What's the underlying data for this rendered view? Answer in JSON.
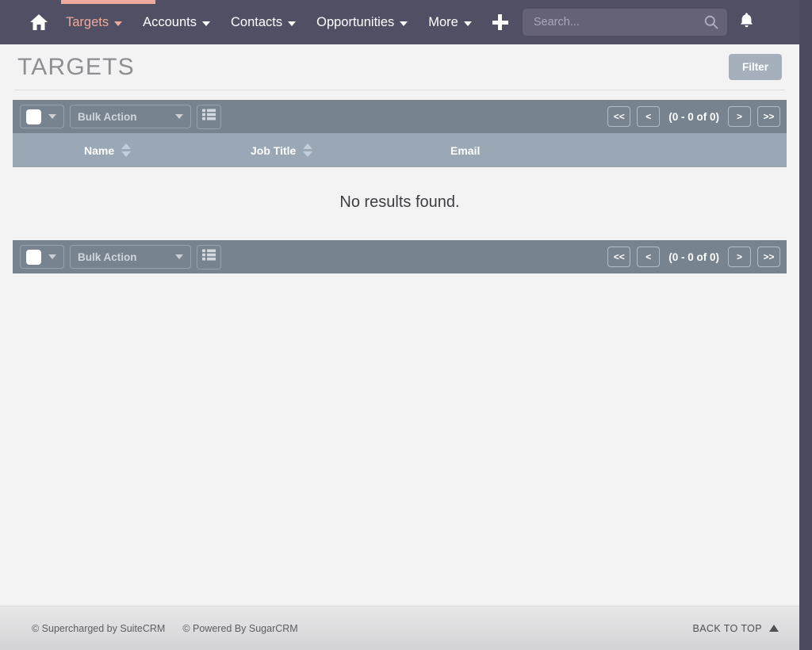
{
  "navbar": {
    "home_icon": "home-icon",
    "plus_icon": "plus-icon",
    "bell_icon": "bell-icon",
    "active_tab": "Targets",
    "items": [
      {
        "label": "Targets",
        "has_caret": true,
        "active": true
      },
      {
        "label": "Accounts",
        "has_caret": true,
        "active": false
      },
      {
        "label": "Contacts",
        "has_caret": true,
        "active": false
      },
      {
        "label": "Opportunities",
        "has_caret": true,
        "active": false
      },
      {
        "label": "More",
        "has_caret": true,
        "active": false
      }
    ],
    "search": {
      "placeholder": "Search...",
      "value": "",
      "icon": "search-icon"
    },
    "colors": {
      "background": "#514f63",
      "active_accent": "#eeaa9c",
      "search_background": "#656277"
    }
  },
  "header": {
    "title": "TARGETS",
    "filter_label": "Filter",
    "filter_color": "#a6b0bd"
  },
  "listview": {
    "toolbar": {
      "select_all_icon": "checkbox-icon",
      "bulk_action_label": "Bulk Action",
      "column_chooser_icon": "list-icon"
    },
    "pagination": {
      "first_label": "<<",
      "prev_label": "<",
      "count_label": "(0 - 0 of 0)",
      "next_label": ">",
      "last_label": ">>"
    },
    "columns": [
      {
        "label": "Name",
        "sortable": true
      },
      {
        "label": "Job Title",
        "sortable": true
      },
      {
        "label": "Email",
        "sortable": false
      }
    ],
    "empty_message": "No results found.",
    "colors": {
      "toolbar_background": "#77838f",
      "header_background": "#9aa7b4"
    }
  },
  "footer": {
    "supercharged": "© Supercharged by SuiteCRM",
    "powered": "© Powered By SugarCRM",
    "back_to_top": "BACK TO TOP"
  }
}
